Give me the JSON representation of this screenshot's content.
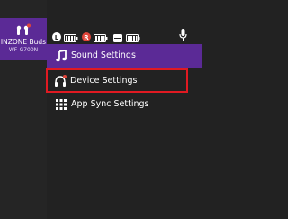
{
  "device": {
    "name": "INZONE Buds",
    "model": "WF-G700N",
    "icon": "earbuds-icon"
  },
  "status": {
    "icons": [
      "left-earbud-icon",
      "battery-full-icon",
      "right-earbud-icon",
      "battery-full-icon",
      "case-icon",
      "battery-full-icon",
      "microphone-icon"
    ]
  },
  "menu": {
    "items": [
      {
        "label": "Sound Settings",
        "icon": "music-note-icon",
        "active": true
      },
      {
        "label": "Device Settings",
        "icon": "headphones-icon",
        "active": false,
        "highlighted": true
      },
      {
        "label": "App Sync Settings",
        "icon": "grid-icon",
        "active": false
      }
    ]
  },
  "colors": {
    "accent": "#5b2a96",
    "highlight_border": "#e01a22",
    "notification_dot": "#e0453a",
    "background": "#222222"
  }
}
